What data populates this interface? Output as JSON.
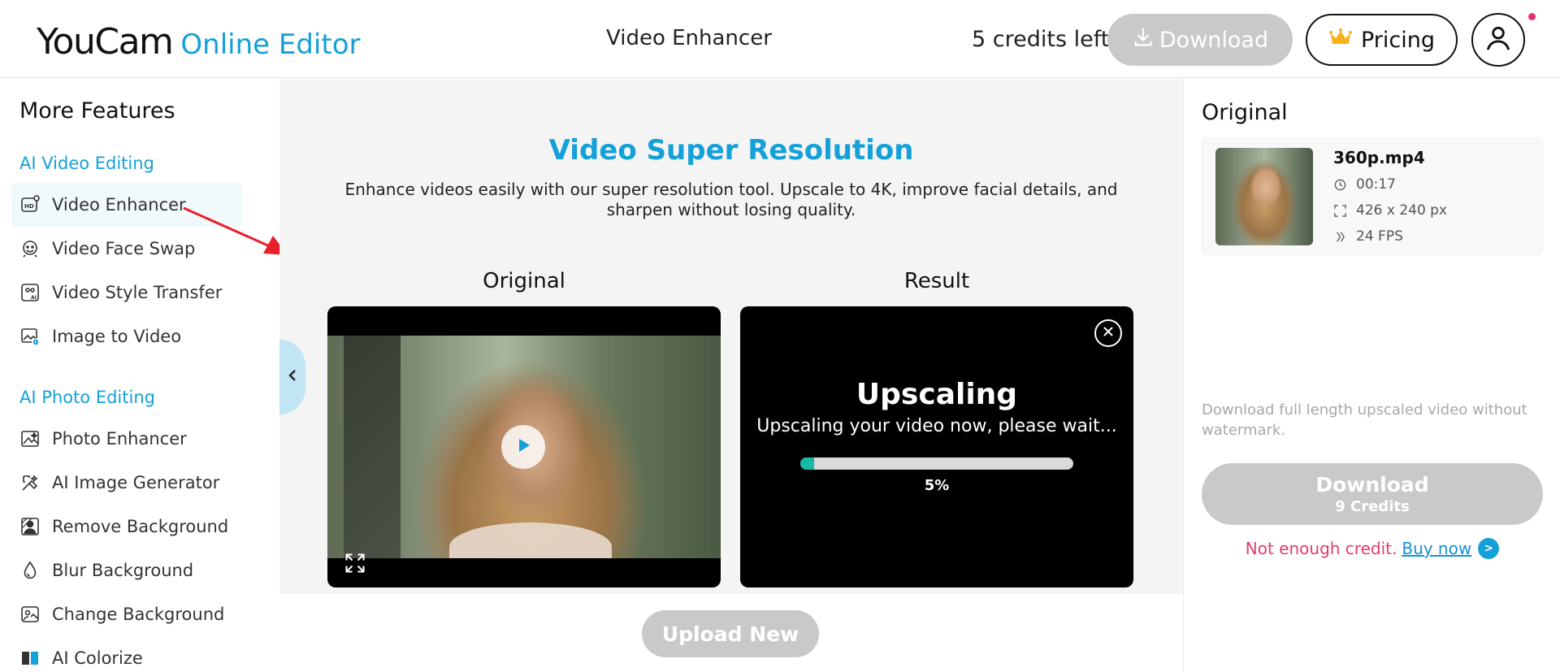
{
  "header": {
    "logo_main": "YouCam",
    "logo_sub": "Online Editor",
    "title": "Video Enhancer",
    "credits": "5 credits left",
    "download_label": "Download",
    "pricing_label": "Pricing"
  },
  "sidebar": {
    "heading": "More Features",
    "sections": [
      {
        "title": "AI Video Editing",
        "items": [
          {
            "label": "Video Enhancer",
            "icon": "hd-video-icon",
            "active": true
          },
          {
            "label": "Video Face Swap",
            "icon": "face-swap-icon"
          },
          {
            "label": "Video Style Transfer",
            "icon": "style-transfer-icon"
          },
          {
            "label": "Image to Video",
            "icon": "image-to-video-icon"
          }
        ]
      },
      {
        "title": "AI Photo Editing",
        "items": [
          {
            "label": "Photo Enhancer",
            "icon": "photo-enhancer-icon"
          },
          {
            "label": "AI Image Generator",
            "icon": "image-generator-icon"
          },
          {
            "label": "Remove Background",
            "icon": "remove-background-icon"
          },
          {
            "label": "Blur Background",
            "icon": "blur-drop-icon"
          },
          {
            "label": "Change Background",
            "icon": "change-background-icon"
          },
          {
            "label": "AI Colorize",
            "icon": "colorize-icon"
          }
        ]
      }
    ]
  },
  "main": {
    "title": "Video Super Resolution",
    "description": "Enhance videos easily with our super resolution tool. Upscale to 4K, improve facial details, and sharpen without losing quality.",
    "original_label": "Original",
    "result_label": "Result",
    "upscaling_title": "Upscaling",
    "upscaling_sub": "Upscaling your video now, please wait...",
    "progress_percent": 5,
    "progress_text": "5%",
    "upload_new_label": "Upload New"
  },
  "right_panel": {
    "heading": "Original",
    "file": {
      "name": "360p.mp4",
      "duration": "00:17",
      "resolution": "426 x 240 px",
      "fps": "24 FPS"
    },
    "note": "Download full length upscaled video without watermark.",
    "download_label": "Download",
    "download_credits": "9 Credits",
    "warning_text": "Not enough credit.",
    "buy_now": "Buy now",
    "go_glyph": ">"
  },
  "colors": {
    "accent": "#14a0d8",
    "disabled": "#c9c9c9",
    "warning": "#e63a6b",
    "progress": "#19b9a8",
    "annotation": "#e8202a"
  }
}
